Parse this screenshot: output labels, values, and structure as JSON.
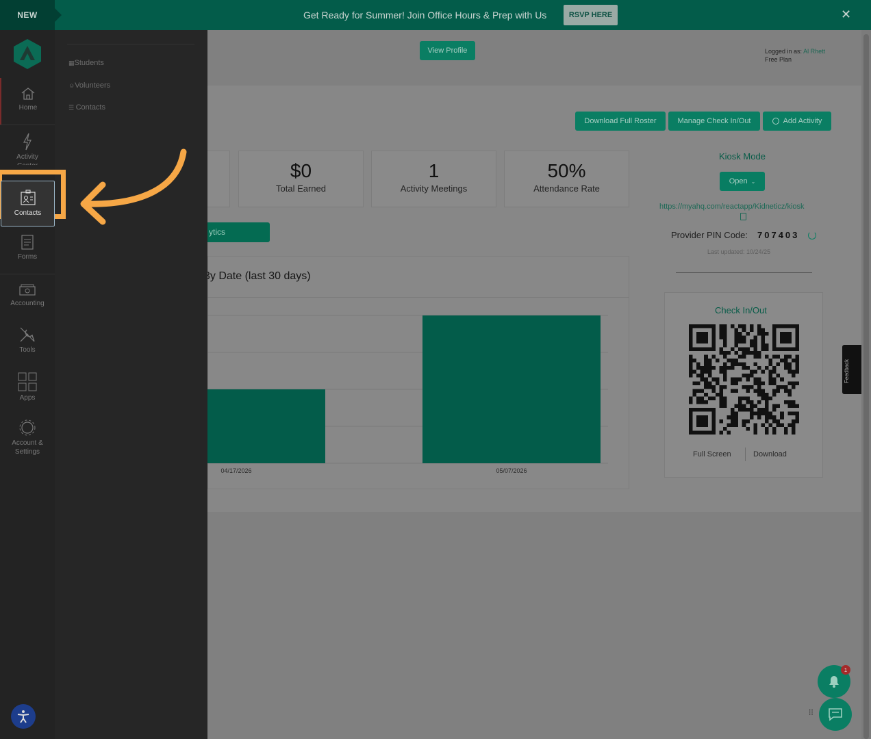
{
  "banner": {
    "badge": "NEW",
    "message": "Get Ready for Summer! Join Office Hours & Prep with Us",
    "rsvp_label": "RSVP HERE",
    "close_icon": "close-icon"
  },
  "sidebar": {
    "items": [
      {
        "label": "Home",
        "icon": "home-icon"
      },
      {
        "label": "Activity Center",
        "icon": "lightning-icon"
      },
      {
        "label": "Contacts",
        "icon": "contacts-icon"
      },
      {
        "label": "Forms",
        "icon": "forms-icon"
      },
      {
        "label": "Accounting",
        "icon": "money-icon"
      },
      {
        "label": "Tools",
        "icon": "tools-icon"
      },
      {
        "label": "Apps",
        "icon": "apps-grid-icon"
      },
      {
        "label": "Account & Settings",
        "icon": "gear-icon"
      }
    ]
  },
  "submenu": {
    "items": [
      {
        "label": "Students",
        "icon": "students-icon"
      },
      {
        "label": "Volunteers",
        "icon": "volunteers-icon"
      },
      {
        "label": "Contacts",
        "icon": "contacts-list-icon"
      }
    ]
  },
  "header": {
    "view_profile": "View Profile",
    "logged_in_prefix": "Logged in as: ",
    "user_name": "Al Rhett",
    "plan": "Free Plan"
  },
  "actions": {
    "download_roster": "Download Full Roster",
    "manage_checkin": "Manage Check In/Out",
    "add_activity": "Add Activity"
  },
  "stats": [
    {
      "value": "$0",
      "label": "Total Earned"
    },
    {
      "value": "1",
      "label": "Activity Meetings"
    },
    {
      "value": "50%",
      "label": "Attendance Rate"
    }
  ],
  "analytics_button": "ytics",
  "chart_data": {
    "type": "bar",
    "title": "3y Date (last 30 days)",
    "categories": [
      "04/17/2026",
      "05/07/2026"
    ],
    "values": [
      2,
      4
    ],
    "ylim": [
      0,
      4
    ],
    "grid": true,
    "bar_color": "#035c4a"
  },
  "kiosk": {
    "title": "Kiosk Mode",
    "open_label": "Open",
    "url": "https://myahq.com/reactapp/Kidneticz/kiosk",
    "pin_label": "Provider PIN Code:",
    "pin_code": "707403",
    "last_updated": "Last updated: 10/24/25"
  },
  "checkin": {
    "title": "Check In/Out",
    "full_screen": "Full Screen",
    "download": "Download"
  },
  "feedback_label": "Feedback",
  "notifications": {
    "badge_count": "1"
  },
  "colors": {
    "brand": "#035c4a",
    "accent": "#0a7e63",
    "highlight": "#f6a746"
  }
}
